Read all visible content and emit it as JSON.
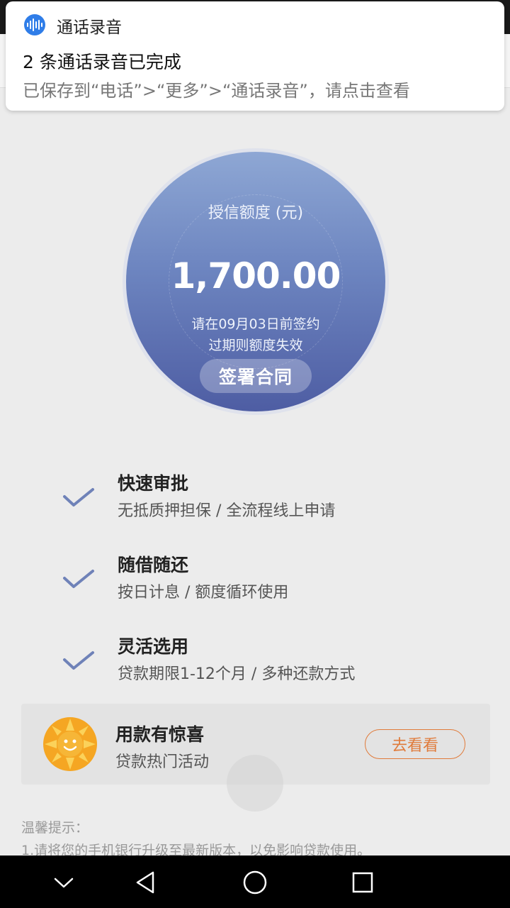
{
  "notification": {
    "app_name": "通话录音",
    "title": "2 条通话录音已完成",
    "text": "已保存到“电话”>“更多”>“通话录音”，请点击查看"
  },
  "credit": {
    "label": "授信额度 (元)",
    "amount": "1,700.00",
    "note_line1": "请在09月03日前签约",
    "note_line2": "过期则额度失效",
    "sign_button": "签署合同"
  },
  "features": [
    {
      "title": "快速审批",
      "desc": "无抵质押担保 / 全流程线上申请"
    },
    {
      "title": "随借随还",
      "desc": "按日计息 / 额度循环使用"
    },
    {
      "title": "灵活选用",
      "desc": "贷款期限1-12个月 / 多种还款方式"
    }
  ],
  "promo": {
    "title": "用款有惊喜",
    "subtitle": "贷款热门活动",
    "button": "去看看",
    "icon": "sun-mascot-icon"
  },
  "tips": {
    "title": "温馨提示：",
    "line1": "1.请将您的手机银行升级至最新版本，以免影响贷款使用。"
  },
  "navbar": {
    "icons": [
      "chevron-down-icon",
      "back-triangle-icon",
      "home-circle-icon",
      "recents-square-icon"
    ]
  },
  "colors": {
    "circle_top": "#8ea7d4",
    "circle_bottom": "#4e5da3",
    "check": "#6f82b8",
    "promo_accent": "#e07b3b",
    "notif_icon": "#2f7de8"
  }
}
